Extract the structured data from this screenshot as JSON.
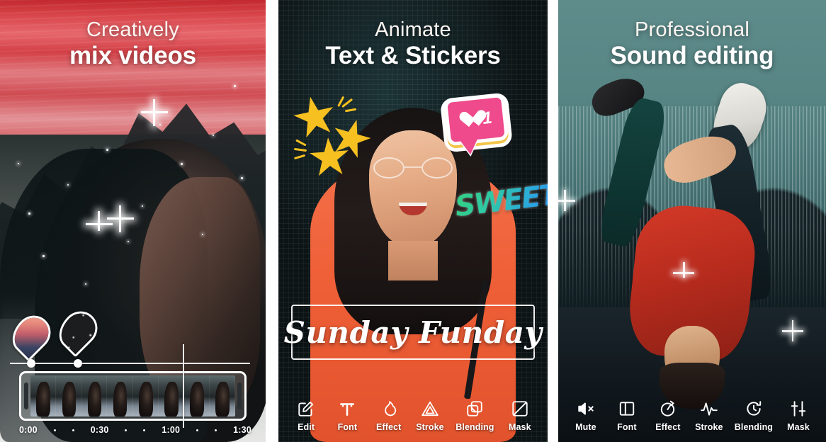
{
  "panels": [
    {
      "id": "mix-videos",
      "headline_thin": "Creatively",
      "headline_bold": "mix videos",
      "timeline": {
        "ticks": [
          "0:00",
          "0:30",
          "1:00",
          "1:30"
        ],
        "pins": [
          "sunset-mountain-thumbnail",
          "starry-night-thumbnail"
        ]
      }
    },
    {
      "id": "text-stickers",
      "headline_thin": "Animate",
      "headline_bold": "Text & Stickers",
      "stickers": {
        "stars": "three-yellow-stars",
        "like_count": "1",
        "sweet": "SWEET"
      },
      "text_overlay": "Sunday Funday",
      "toolbar": [
        {
          "label": "Edit",
          "icon": "edit-pencil-icon"
        },
        {
          "label": "Font",
          "icon": "font-t-icon"
        },
        {
          "label": "Effect",
          "icon": "effect-flame-icon"
        },
        {
          "label": "Stroke",
          "icon": "stroke-triangle-icon"
        },
        {
          "label": "Blending",
          "icon": "blending-layers-icon"
        },
        {
          "label": "Mask",
          "icon": "mask-square-icon"
        }
      ]
    },
    {
      "id": "sound-editing",
      "headline_thin": "Professional",
      "headline_bold": "Sound editing",
      "toolbar": [
        {
          "label": "Mute",
          "icon": "mute-speaker-icon"
        },
        {
          "label": "Font",
          "icon": "split-panel-icon"
        },
        {
          "label": "Effect",
          "icon": "effect-circle-arrow-icon"
        },
        {
          "label": "Stroke",
          "icon": "waveform-icon"
        },
        {
          "label": "Blending",
          "icon": "clock-rotate-icon"
        },
        {
          "label": "Mask",
          "icon": "sliders-icon"
        }
      ]
    }
  ],
  "colors": {
    "sticker_pink": "#ef4a8b",
    "sticker_yellow": "#f6c020",
    "sweet_green": "#34d07f",
    "sweet_blue": "#2b84e8",
    "orange_top": "#ef6038",
    "red_jacket": "#b92c1e"
  }
}
